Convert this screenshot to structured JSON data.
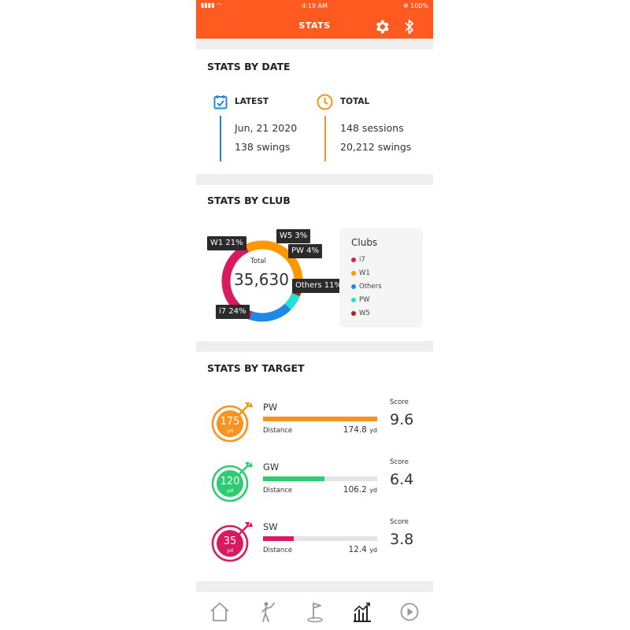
{
  "status_bar": {
    "signal": "▮▮▮▮ ◠",
    "time": "4:19 AM",
    "battery": "✲ 100%"
  },
  "header": {
    "title": "STATS"
  },
  "stats_by_date": {
    "title": "STATS BY DATE",
    "latest": {
      "label": "LATEST",
      "date": "Jun, 21  2020",
      "swings": "138 swings"
    },
    "total": {
      "label": "TOTAL",
      "sessions": "148 sessions",
      "swings": "20,212 swings"
    }
  },
  "stats_by_club": {
    "title": "STATS BY CLUB",
    "total_label": "Total",
    "total_value": "35,630",
    "legend_title": "Clubs",
    "tags": {
      "w1": "W1 21%",
      "w5": "W5 3%",
      "pw": "PW 4%",
      "others": "Others 11%",
      "i7": "i7 24%"
    },
    "legend": [
      {
        "name": "i7",
        "color": "#d81b60"
      },
      {
        "name": "W1",
        "color": "#ff9800"
      },
      {
        "name": "Others",
        "color": "#1e88e5"
      },
      {
        "name": "PW",
        "color": "#26e0d8"
      },
      {
        "name": "W5",
        "color": "#b71c1c"
      }
    ],
    "segments": [
      {
        "club": "W1",
        "percent": 21,
        "color": "#ff9800"
      },
      {
        "club": "W5",
        "percent": 3,
        "color": "#b71c1c"
      },
      {
        "club": "PW",
        "percent": 4,
        "color": "#26e0d8"
      },
      {
        "club": "Others",
        "percent": 11,
        "color": "#1e88e5"
      },
      {
        "club": "i7",
        "percent": 24,
        "color": "#d81b60"
      }
    ]
  },
  "stats_by_target": {
    "title": "STATS BY TARGET",
    "rows": [
      {
        "target": "175",
        "unit": "yd",
        "club": "PW",
        "distance_label": "Distance",
        "distance": "174.8",
        "distance_unit": "yd",
        "score_label": "Score",
        "score": "9.6",
        "fill": 1.0,
        "color": "#f7931e"
      },
      {
        "target": "120",
        "unit": "yd",
        "club": "GW",
        "distance_label": "Distance",
        "distance": "106.2",
        "distance_unit": "yd",
        "score_label": "Score",
        "score": "6.4",
        "fill": 0.54,
        "color": "#2ecc71"
      },
      {
        "target": "35",
        "unit": "yd",
        "club": "SW",
        "distance_label": "Distance",
        "distance": "12.4",
        "distance_unit": "yd",
        "score_label": "Score",
        "score": "3.8",
        "fill": 0.27,
        "color": "#d81b60"
      }
    ]
  },
  "nav": {
    "items": [
      "home-icon",
      "golfer-icon",
      "golf-flag-icon",
      "stats-icon",
      "play-icon"
    ],
    "active": "stats-icon"
  },
  "colors": {
    "header": "#ff5a1f",
    "latest": "#1e88e5",
    "total": "#f7931e"
  }
}
